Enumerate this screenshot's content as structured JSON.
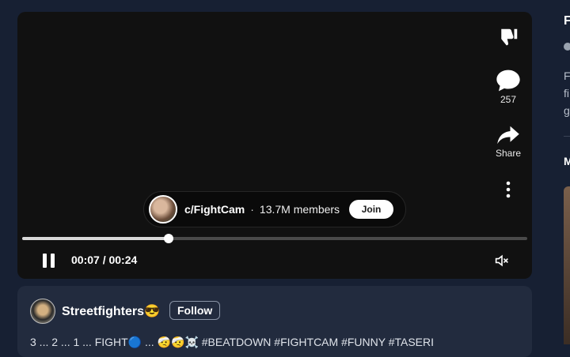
{
  "video": {
    "comments_count": "257",
    "share_label": "Share",
    "community_name": "c/FightCam",
    "separator": "·",
    "members": "13.7M members",
    "join_label": "Join",
    "time": "00:07 / 00:24",
    "progress_fraction": 0.29,
    "icons": [
      "dislike-icon",
      "comment-icon",
      "share-icon",
      "more-icon",
      "pause-icon",
      "muted-icon"
    ]
  },
  "post": {
    "username": "Streetfighters😎",
    "follow_label": "Follow",
    "text": "3 ... 2 ... 1 ... FIGHT🔵 ... 🤕🤕☠️ #BEATDOWN #FIGHTCAM #FUNNY #TASERI"
  },
  "sidebar": {
    "title": "F",
    "text": "F\nfi\ng",
    "sub_title": "M"
  }
}
